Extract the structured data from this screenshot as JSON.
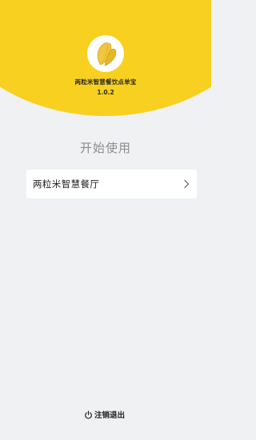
{
  "header": {
    "app_name": "两粒米智慧餐饮点单宝",
    "version": "1.0.2",
    "logo_icon": "rice-grain-icon",
    "accent_color": "#f8d01f"
  },
  "main": {
    "title": "开始使用",
    "stores": [
      {
        "label": "两粒米智慧餐厅"
      }
    ]
  },
  "footer": {
    "logout_label": "注销退出",
    "logout_icon": "power-icon"
  }
}
